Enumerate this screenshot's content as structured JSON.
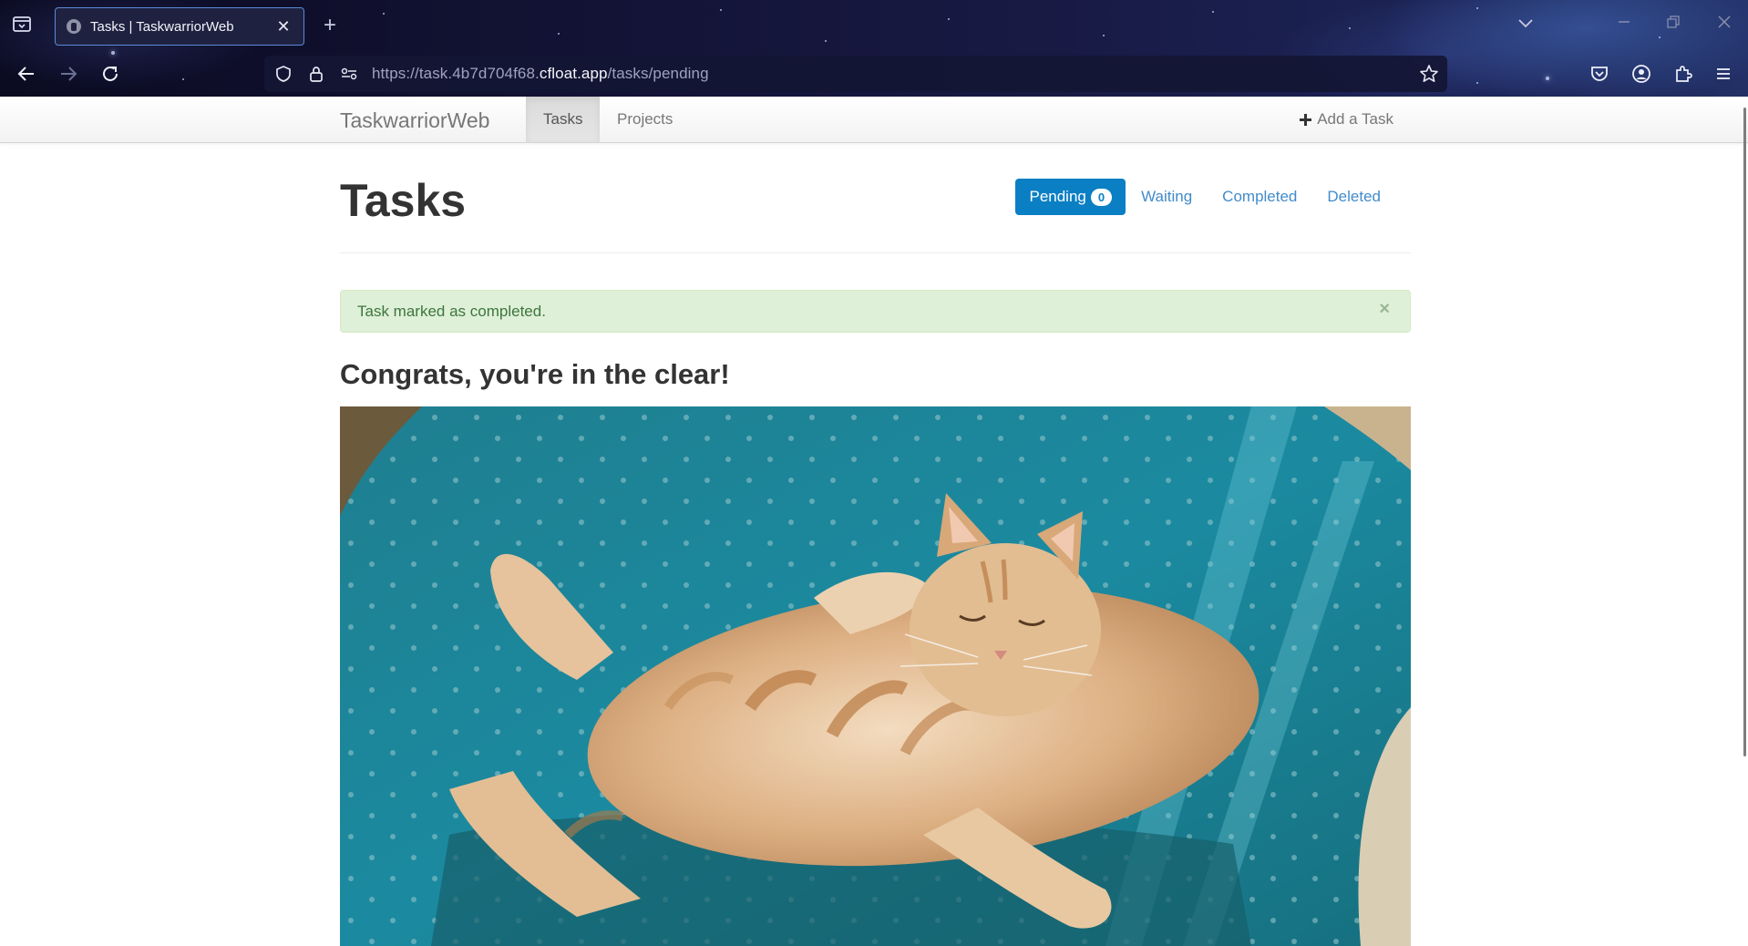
{
  "browser": {
    "tab_title": "Tasks | TaskwarriorWeb",
    "new_tab_symbol": "+",
    "close_symbol": "✕",
    "url_prefix": "https://task.4b7d704f68.",
    "url_host": "cfloat.app",
    "url_path": "/tasks/pending"
  },
  "site": {
    "brand": "TaskwarriorWeb",
    "nav": {
      "tasks": "Tasks",
      "projects": "Projects",
      "add_task": "Add a Task"
    }
  },
  "main": {
    "title": "Tasks",
    "filters": {
      "pending_label": "Pending",
      "pending_count": "0",
      "waiting_label": "Waiting",
      "completed_label": "Completed",
      "deleted_label": "Deleted"
    },
    "alert": {
      "message": "Task marked as completed.",
      "close_symbol": "×"
    },
    "empty_heading": "Congrats, you're in the clear!"
  },
  "colors": {
    "accent": "#0b7fc4",
    "link": "#428bca",
    "alert_bg": "#dff0d8",
    "alert_text": "#3c763d",
    "chair_teal": "#1e7f8f",
    "cat_orange": "#d8a26a"
  },
  "icons": {
    "tab_list": "tab-list-icon",
    "back": "arrow-left-icon",
    "forward": "arrow-right-icon",
    "reload": "reload-icon",
    "shield": "shield-icon",
    "lock": "lock-icon",
    "permissions": "permissions-icon",
    "bookmark": "star-icon",
    "pocket": "pocket-icon",
    "account": "account-icon",
    "extensions": "puzzle-icon",
    "menu": "hamburger-menu-icon",
    "add": "plus-icon"
  }
}
